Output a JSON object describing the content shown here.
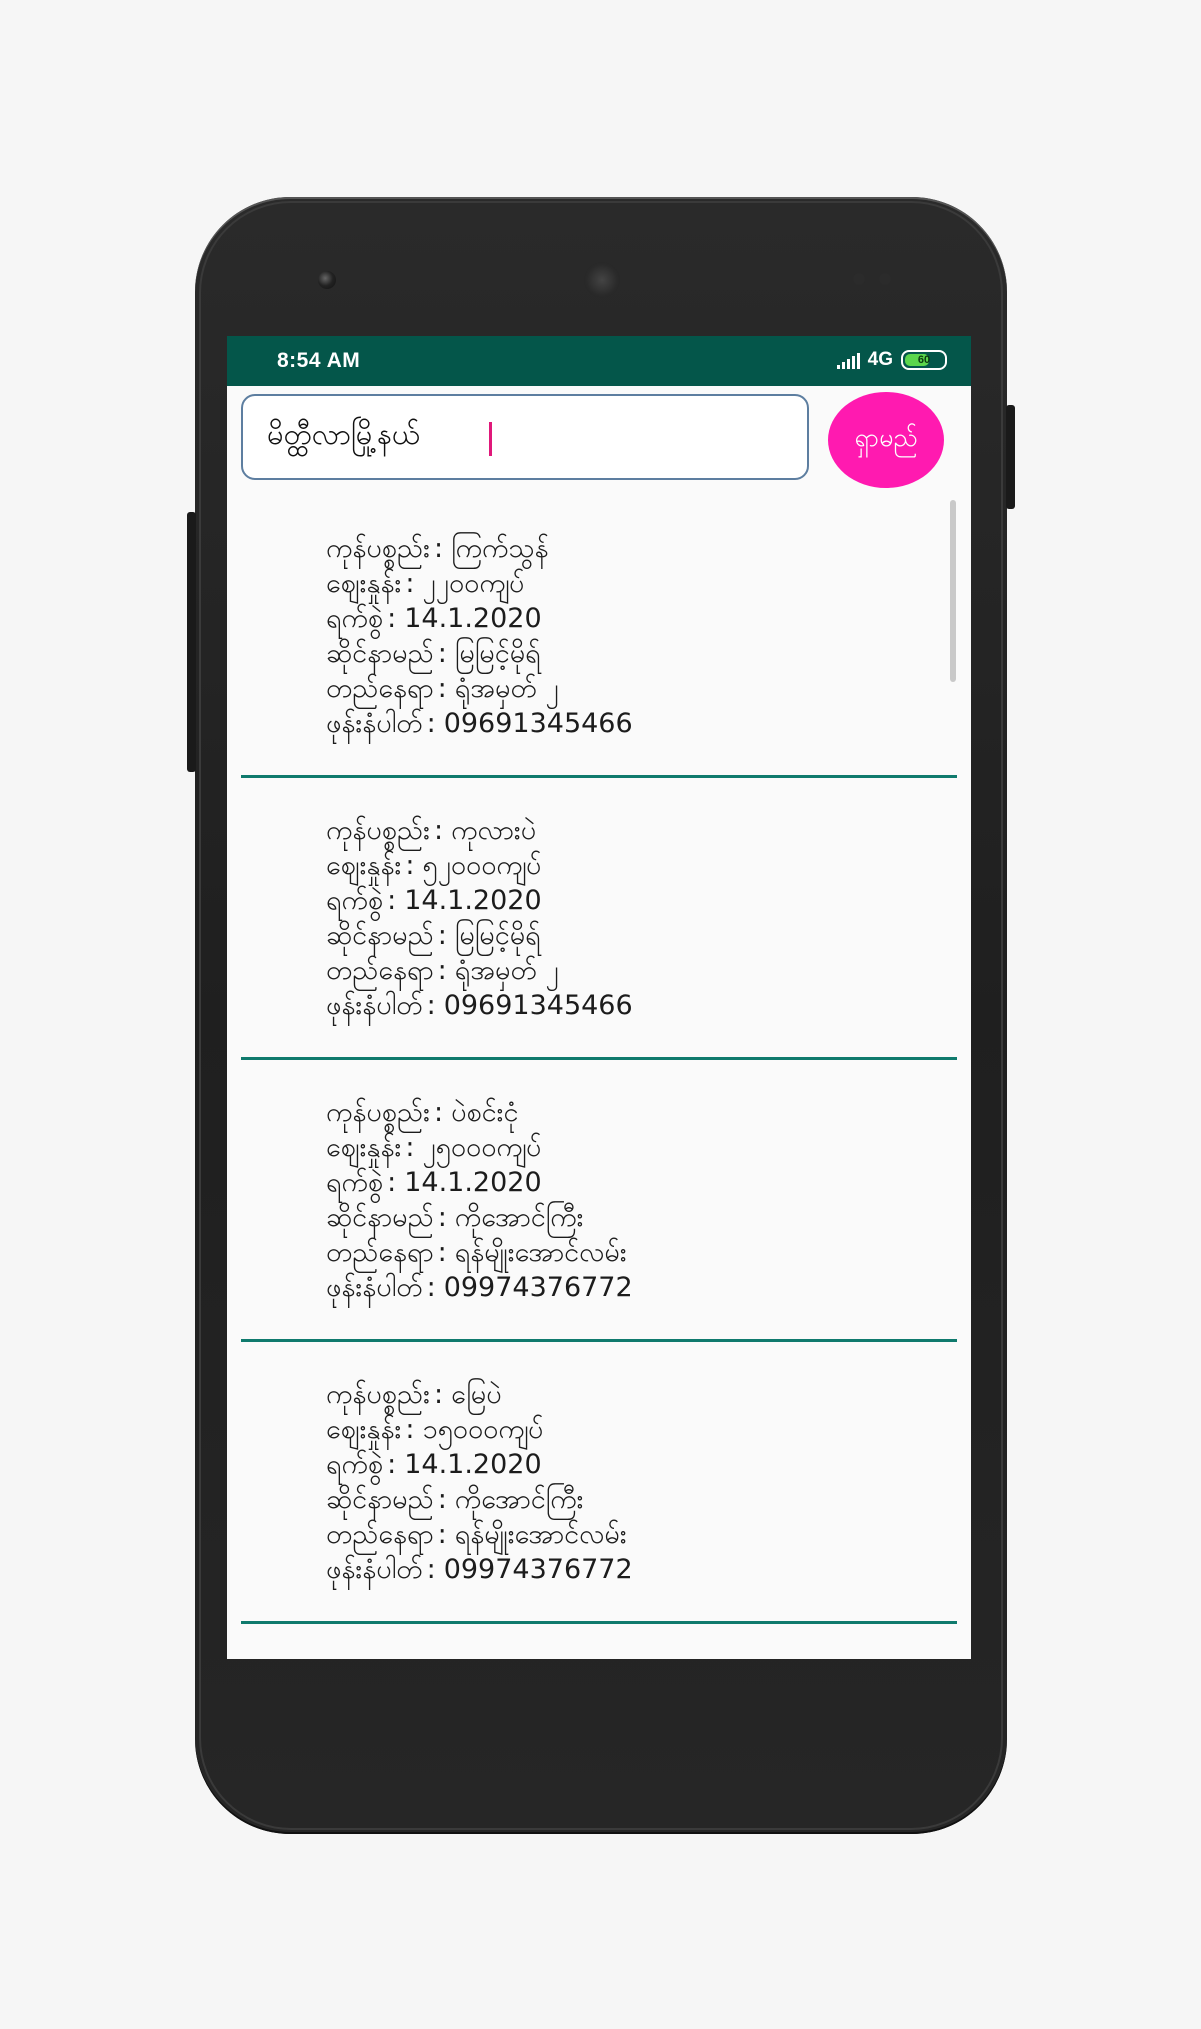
{
  "status_bar": {
    "time": "8:54 AM",
    "network": "4G",
    "battery_level": "60",
    "signal_icon": "signal-bars-icon",
    "battery_icon": "battery-icon",
    "bg_color": "#04564a"
  },
  "search": {
    "value": "မိတ္ထီလာမြို့နယ်",
    "button_label": "ရှာမည်",
    "button_color": "#ff1ab0"
  },
  "list": {
    "divider_color": "#0f7a6d",
    "items": [
      {
        "product_label": "ကုန်ပစ္စည်း",
        "product": "ကြက်သွန်",
        "price_label": "ဈေးနှုန်း",
        "price": "၂၂၀၀ကျပ်",
        "date_label": "ရက်စွဲ",
        "date": "14.1.2020",
        "shop_label": "ဆိုင်နာမည်",
        "shop": "မြမြင့်မိုရ်",
        "address_label": "တည်နေရာ",
        "address": "ရုံအမှတ် ၂",
        "phone_label": "ဖုန်းနံပါတ်",
        "phone": "09691345466"
      },
      {
        "product_label": "ကုန်ပစ္စည်း",
        "product": "ကုလားပဲ",
        "price_label": "ဈေးနှုန်း",
        "price": "၅၂၀၀၀ကျပ်",
        "date_label": "ရက်စွဲ",
        "date": "14.1.2020",
        "shop_label": "ဆိုင်နာမည်",
        "shop": "မြမြင့်မိုရ်",
        "address_label": "တည်နေရာ",
        "address": "ရုံအမှတ် ၂",
        "phone_label": "ဖုန်းနံပါတ်",
        "phone": "09691345466"
      },
      {
        "product_label": "ကုန်ပစ္စည်း",
        "product": "ပဲစင်းငုံ",
        "price_label": "ဈေးနှုန်း",
        "price": "၂၅၀၀၀ကျပ်",
        "date_label": "ရက်စွဲ",
        "date": "14.1.2020",
        "shop_label": "ဆိုင်နာမည်",
        "shop": "ကိုအောင်ကြီး",
        "address_label": "တည်နေရာ",
        "address": "ရန်မျိုးအောင်လမ်း",
        "phone_label": "ဖုန်းနံပါတ်",
        "phone": "09974376772"
      },
      {
        "product_label": "ကုန်ပစ္စည်း",
        "product": "မြေပဲ",
        "price_label": "ဈေးနှုန်း",
        "price": "၁၅၀၀၀ကျပ်",
        "date_label": "ရက်စွဲ",
        "date": "14.1.2020",
        "shop_label": "ဆိုင်နာမည်",
        "shop": "ကိုအောင်ကြီး",
        "address_label": "တည်နေရာ",
        "address": "ရန်မျိုးအောင်လမ်း",
        "phone_label": "ဖုန်းနံပါတ်",
        "phone": "09974376772"
      }
    ]
  }
}
